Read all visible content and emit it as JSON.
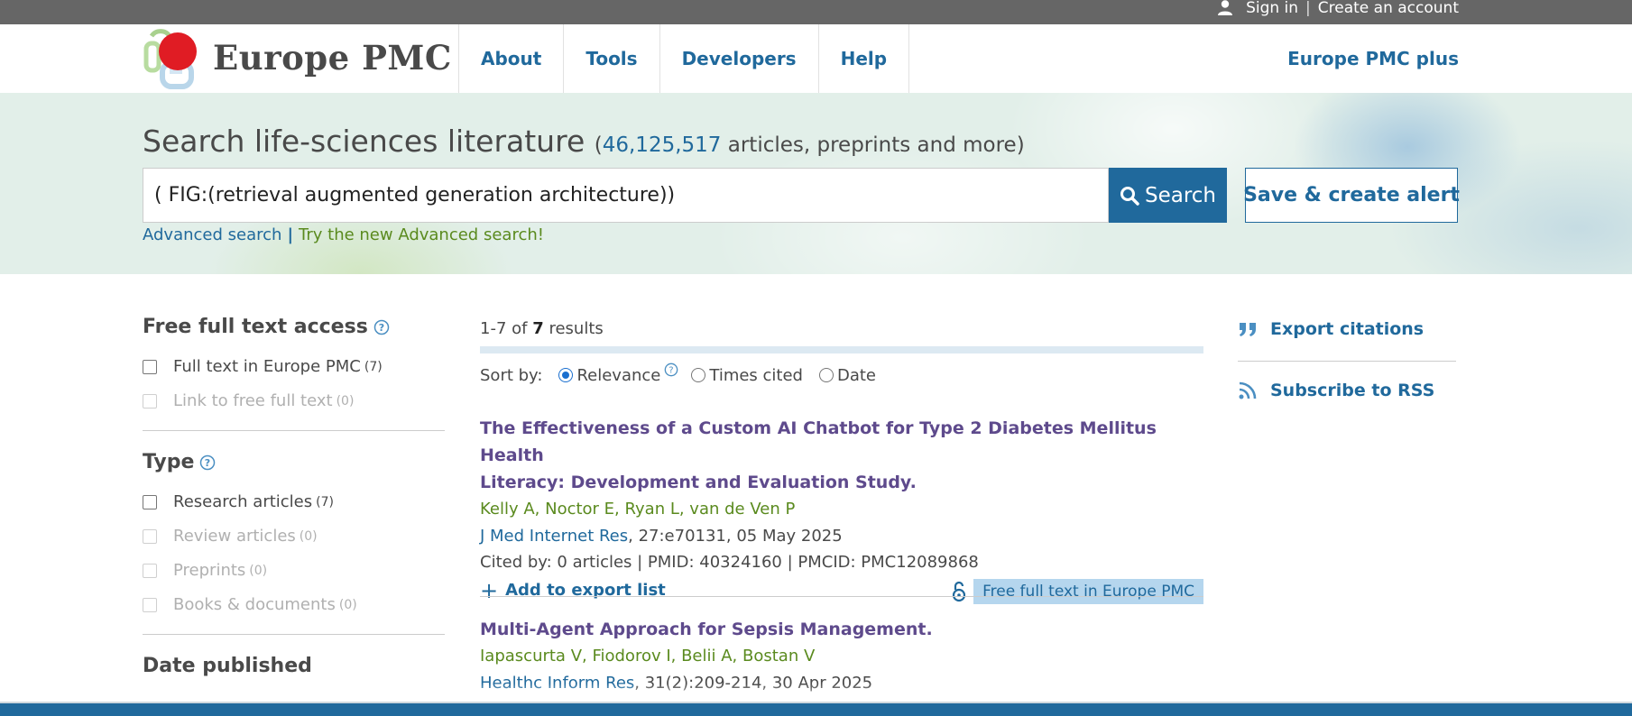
{
  "account": {
    "sign_in": "Sign in",
    "separator": "|",
    "create_account": "Create an account"
  },
  "brand": {
    "name": "Europe PMC",
    "colors": {
      "primary": "#20699c",
      "link_green": "#5a8a1e",
      "title_purple": "#5e4a8c",
      "logo_red": "#e01c24"
    }
  },
  "nav": {
    "items": [
      {
        "label": "About"
      },
      {
        "label": "Tools"
      },
      {
        "label": "Developers"
      },
      {
        "label": "Help"
      }
    ],
    "plus": "Europe PMC plus"
  },
  "search": {
    "heading": "Search life-sciences literature",
    "count_open": "(",
    "count": "46,125,517",
    "count_suffix": " articles, preprints and more)",
    "query": "( FIG:(retrieval augmented generation architecture))",
    "search_button": "Search",
    "alert_button": "Save & create alert",
    "advanced": "Advanced search",
    "adv_sep": "|",
    "try_new": "Try the new Advanced search!"
  },
  "facets": {
    "access": {
      "title": "Free full text access",
      "options": [
        {
          "label": "Full text in Europe PMC",
          "count": "(7)",
          "enabled": true
        },
        {
          "label": "Link to free full text",
          "count": "(0)",
          "enabled": false
        }
      ]
    },
    "type": {
      "title": "Type",
      "options": [
        {
          "label": "Research articles",
          "count": "(7)",
          "enabled": true
        },
        {
          "label": "Review articles",
          "count": "(0)",
          "enabled": false
        },
        {
          "label": "Preprints",
          "count": "(0)",
          "enabled": false
        },
        {
          "label": "Books & documents",
          "count": "(0)",
          "enabled": false
        }
      ]
    },
    "date": {
      "title": "Date published"
    }
  },
  "results": {
    "range": "1-7",
    "of": " of ",
    "total": "7",
    "results_word": " results",
    "sort": {
      "label": "Sort by:",
      "options": [
        "Relevance",
        "Times cited",
        "Date"
      ],
      "selected": "Relevance"
    },
    "items": [
      {
        "title_line1": "The Effectiveness of a Custom AI Chatbot for Type 2 Diabetes Mellitus Health",
        "title_line2": "Literacy: Development and Evaluation Study.",
        "authors": "Kelly A, Noctor E, Ryan L, van de Ven P",
        "journal": "J Med Internet Res",
        "details": ", 27:e70131, 05 May 2025",
        "cited": "Cited by: 0 articles | PMID: 40324160 | PMCID: PMC12089868",
        "add_export": "Add to export list",
        "free_text": "Free full text in Europe PMC"
      },
      {
        "title_line1": "Multi-Agent Approach for Sepsis Management.",
        "authors": "Iapascurta V, Fiodorov I, Belii A, Bostan V",
        "journal": "Healthc Inform Res",
        "details": ", 31(2):209-214, 30 Apr 2025"
      }
    ]
  },
  "right_sidebar": {
    "export": "Export citations",
    "rss": "Subscribe to RSS"
  },
  "icons": [
    "user-icon",
    "logo-mark",
    "search-icon",
    "help-icon",
    "plus-icon",
    "open-access-lock-icon",
    "quote-icon",
    "rss-icon"
  ]
}
